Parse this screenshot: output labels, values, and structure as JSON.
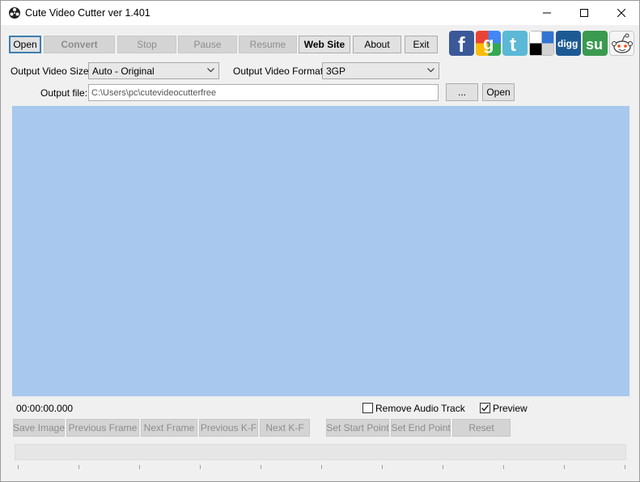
{
  "window": {
    "title": "Cute Video Cutter ver 1.401"
  },
  "toolbar": {
    "open": "Open",
    "convert": "Convert",
    "stop": "Stop",
    "pause": "Pause",
    "resume": "Resume",
    "website": "Web Site",
    "about": "About",
    "exit": "Exit"
  },
  "social_icons": [
    "facebook-icon",
    "google-icon",
    "twitter-icon",
    "delicious-icon",
    "digg-icon",
    "stumbleupon-icon",
    "reddit-icon"
  ],
  "social_text": {
    "facebook": "f",
    "google": "g",
    "twitter": "t",
    "digg": "digg",
    "stumbleupon": "su"
  },
  "output": {
    "size_label": "Output Video Size:",
    "size_value": "Auto - Original",
    "format_label": "Output Video Format:",
    "format_value": "3GP",
    "file_label": "Output file:",
    "file_value": "C:\\Users\\pc\\cutevideocutterfree",
    "browse_label": "...",
    "open_label": "Open"
  },
  "player": {
    "timecode": "00:00:00.000",
    "remove_audio_label": "Remove Audio Track",
    "remove_audio_checked": false,
    "preview_label": "Preview",
    "preview_checked": true
  },
  "controls": {
    "save_image": "Save Image",
    "previous_frame": "Previous Frame",
    "next_frame": "Next Frame",
    "previous_kf": "Previous K-F",
    "next_kf": "Next K-F",
    "set_start": "Set  Start Point",
    "set_end": "Set  End Point",
    "reset": "Reset"
  },
  "colors": {
    "video_background": "#a8c8ee",
    "focus_border": "#3c7fb1"
  }
}
